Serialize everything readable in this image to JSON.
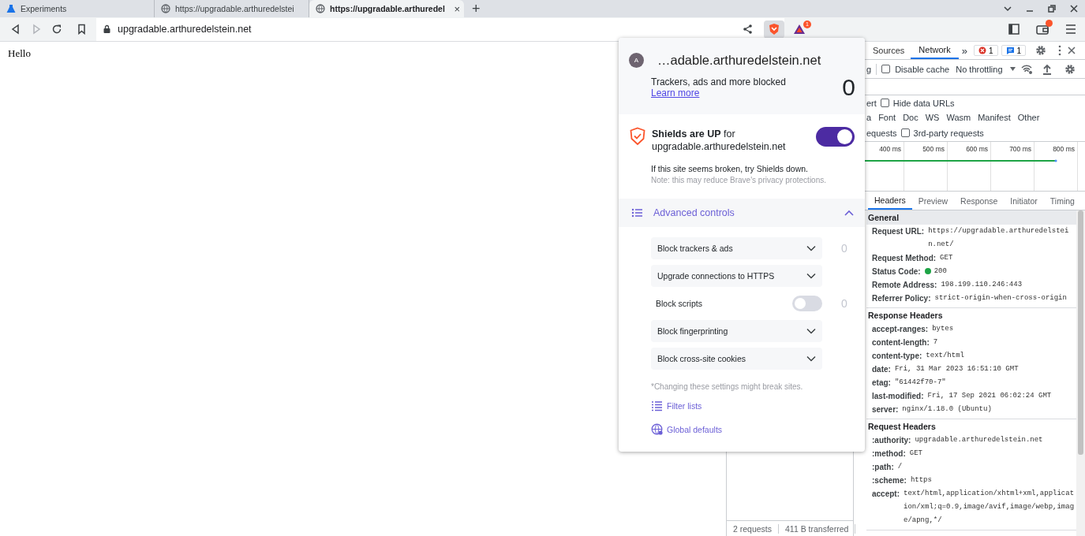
{
  "browser": {
    "tabs": [
      {
        "title": "Experiments",
        "selected": false
      },
      {
        "title": "https://upgradable.arthuredelstei",
        "selected": false
      },
      {
        "title": "https://upgradable.arthuredel",
        "selected": true,
        "close": "×"
      }
    ],
    "new_tab": "+",
    "address": "upgradable.arthuredelstein.net",
    "rewards_badge": "1"
  },
  "page": {
    "text": "Hello"
  },
  "devtools": {
    "panel_tabs": [
      {
        "label": "Sources",
        "selected": false
      },
      {
        "label": "Network",
        "selected": true
      }
    ],
    "more_tabs": "»",
    "error_count": "1",
    "message_count": "1",
    "toolbar": {
      "fragment": "g",
      "disable_cache": {
        "label": "Disable cache",
        "checked": false
      },
      "throttling": "No throttling"
    },
    "filter_row": {
      "fragment": "ert",
      "hide_data_urls": {
        "label": "Hide data URLs",
        "checked": false
      }
    },
    "type_filters": [
      "a",
      "Font",
      "Doc",
      "WS",
      "Wasm",
      "Manifest",
      "Other"
    ],
    "requests_row": {
      "fragment": "equests",
      "third_party": {
        "label": "3rd-party requests",
        "checked": false
      }
    },
    "timeline_ticks": [
      "400 ms",
      "500 ms",
      "600 ms",
      "700 ms",
      "800 ms"
    ],
    "detail_tabs": [
      {
        "label": "Headers",
        "selected": true
      },
      {
        "label": "Preview",
        "selected": false
      },
      {
        "label": "Response",
        "selected": false
      },
      {
        "label": "Initiator",
        "selected": false
      },
      {
        "label": "Timing",
        "selected": false
      }
    ],
    "sections": [
      {
        "title": "General",
        "shaded": true,
        "items": [
          {
            "name": "Request URL:",
            "value": "https://upgradable.arthuredelstein.net/"
          },
          {
            "name": "Request Method:",
            "value": "GET"
          },
          {
            "name": "Status Code:",
            "value": "200",
            "color": "#1ea446"
          },
          {
            "name": "Remote Address:",
            "value": "198.199.110.246:443"
          },
          {
            "name": "Referrer Policy:",
            "value": "strict-origin-when-cross-origin"
          }
        ]
      },
      {
        "title": "Response Headers",
        "shaded": false,
        "items": [
          {
            "name": "accept-ranges:",
            "value": "bytes"
          },
          {
            "name": "content-length:",
            "value": "7"
          },
          {
            "name": "content-type:",
            "value": "text/html"
          },
          {
            "name": "date:",
            "value": "Fri, 31 Mar 2023 16:51:10 GMT"
          },
          {
            "name": "etag:",
            "value": "\"61442f70-7\""
          },
          {
            "name": "last-modified:",
            "value": "Fri, 17 Sep 2021 06:02:24 GMT"
          },
          {
            "name": "server:",
            "value": "nginx/1.18.0 (Ubuntu)"
          }
        ]
      },
      {
        "title": "Request Headers",
        "shaded": false,
        "items": [
          {
            "name": ":authority:",
            "value": "upgradable.arthuredelstein.net"
          },
          {
            "name": ":method:",
            "value": "GET"
          },
          {
            "name": ":path:",
            "value": "/"
          },
          {
            "name": ":scheme:",
            "value": "https"
          },
          {
            "name": "accept:",
            "value": "text/html,application/xhtml+xml,application/xml;q=0.9,image/avif,image/webp,image/apng,*/"
          }
        ]
      }
    ],
    "status_bar": {
      "requests": "2 requests",
      "transferred": "411 B transferred"
    }
  },
  "shields_panel": {
    "avatar": "A",
    "site": "…adable.arthuredelstein.net",
    "blocked_label": "Trackers, ads and more blocked",
    "learn_more": "Learn more",
    "blocked_count": "0",
    "status": "**Shields are UP** for upgradable.arthuredelstein.net",
    "shields_on": true,
    "hint": "If this site seems broken, try Shields down.",
    "note": "Note: this may reduce Brave's privacy protections.",
    "advanced": {
      "label": "Advanced controls",
      "expanded": true
    },
    "controls": [
      {
        "kind": "dropdown",
        "label": "Block trackers & ads",
        "count": "0"
      },
      {
        "kind": "dropdown",
        "label": "Upgrade connections to HTTPS"
      },
      {
        "kind": "toggle",
        "label": "Block scripts",
        "on": false,
        "count": "0"
      },
      {
        "kind": "dropdown",
        "label": "Block fingerprinting"
      },
      {
        "kind": "dropdown",
        "label": "Block cross-site cookies"
      }
    ],
    "warning": "*Changing these settings might break sites.",
    "links": [
      {
        "kind": "filters",
        "label": "Filter lists"
      },
      {
        "kind": "globe",
        "label": "Global defaults"
      }
    ]
  }
}
